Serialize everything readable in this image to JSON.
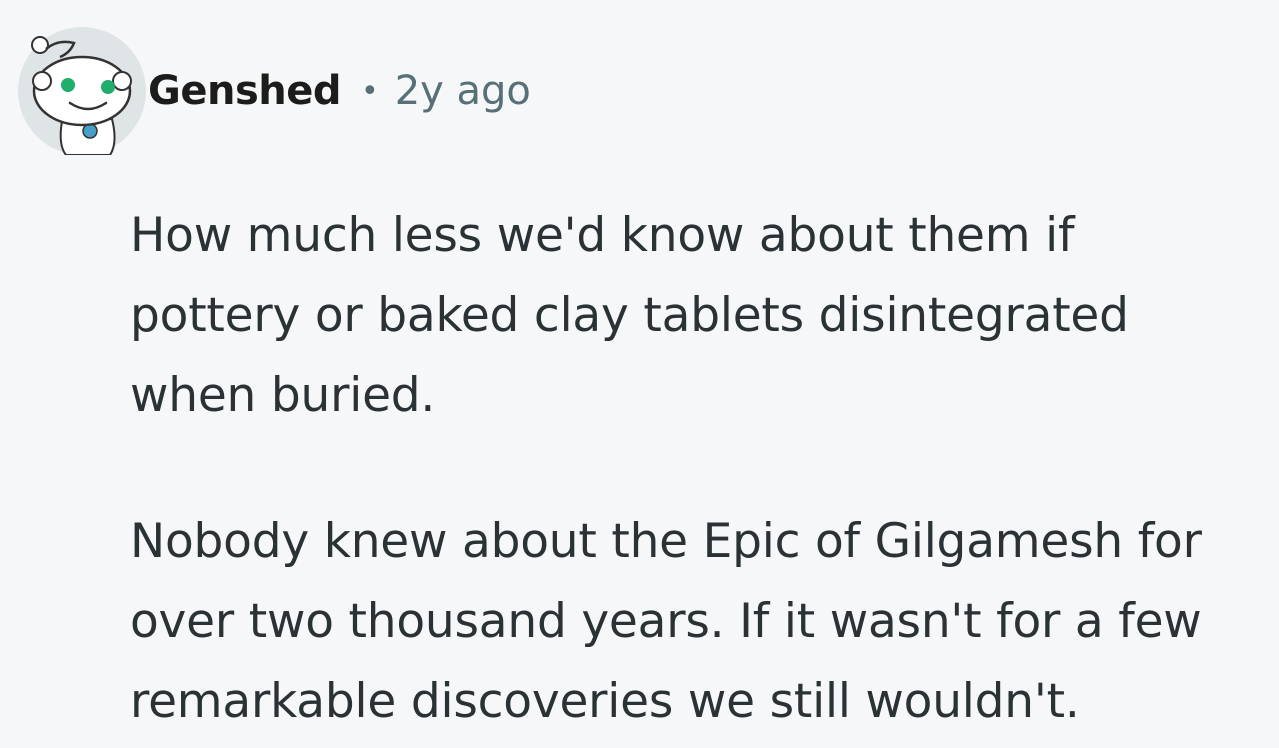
{
  "comment": {
    "author": "Genshed",
    "separator": "•",
    "timestamp": "2y ago",
    "avatar_icon": "snoo-avatar-icon",
    "paragraphs": [
      [
        "How much less we'd know about them if",
        "pottery or baked clay tablets disintegrated",
        "when buried."
      ],
      [
        "Nobody knew about the Epic of Gilgamesh for",
        "over two thousand years. If it wasn't for a few",
        "remarkable discoveries we still wouldn't."
      ]
    ]
  },
  "colors": {
    "background": "#f6f7f8",
    "author": "#1c1c1c",
    "meta": "#576f76",
    "body_text": "#2a3236"
  }
}
